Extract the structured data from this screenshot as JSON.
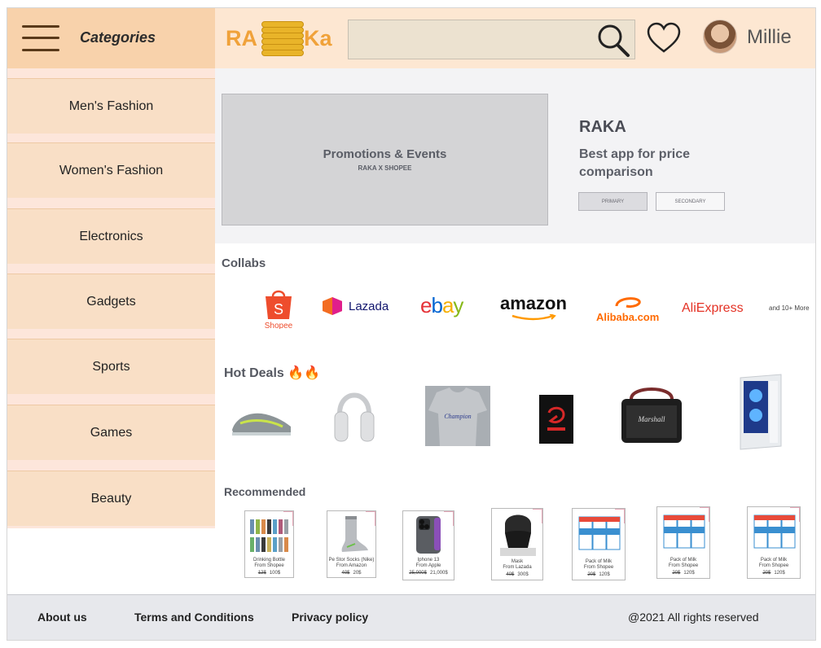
{
  "header": {
    "categories_title": "Categories",
    "logo_left": "RA",
    "logo_right": "Ka",
    "search_placeholder": "",
    "user_name": "Millie"
  },
  "sidebar": {
    "items": [
      {
        "label": "Men's Fashion"
      },
      {
        "label": "Women's Fashion"
      },
      {
        "label": "Electronics"
      },
      {
        "label": "Gadgets"
      },
      {
        "label": "Sports"
      },
      {
        "label": "Games"
      },
      {
        "label": "Beauty"
      }
    ]
  },
  "hero": {
    "promo_title": "Promotions & Events",
    "promo_subtitle": "RAKA X SHOPEE",
    "title": "RAKA",
    "description": "Best app for price comparison",
    "primary_label": "PRIMARY",
    "secondary_label": "SECONDARY"
  },
  "collabs": {
    "title": "Collabs",
    "brands": [
      "Shopee",
      "Lazada",
      "ebay",
      "amazon",
      "Alibaba.com",
      "AliExpress"
    ],
    "more": "and 10+ More"
  },
  "hot_deals": {
    "title": "Hot Deals 🔥🔥",
    "items": [
      "sneaker",
      "headphones",
      "t-shirt",
      "game-card",
      "speaker",
      "gaming-pc"
    ]
  },
  "recommended": {
    "title": "Recommended",
    "items": [
      {
        "name": "Drinking Bottle",
        "source": "From Shopee",
        "old_price": "12$",
        "price": "100$"
      },
      {
        "name": "Pe Stor Socks (Nike)",
        "source": "From Amazon",
        "old_price": "40$",
        "price": "20$"
      },
      {
        "name": "Iphone 13",
        "source": "From Apple",
        "old_price": "25,000$",
        "price": "21,000$"
      },
      {
        "name": "Mask",
        "source": "From Lazada",
        "old_price": "40$",
        "price": "300$"
      },
      {
        "name": "Pack of Milk",
        "source": "From Shopee",
        "old_price": "20$",
        "price": "120$"
      },
      {
        "name": "Pack of Milk",
        "source": "From Shopee",
        "old_price": "20$",
        "price": "120$"
      },
      {
        "name": "Pack of Milk",
        "source": "From Shopee",
        "old_price": "20$",
        "price": "120$"
      }
    ]
  },
  "footer": {
    "about": "About us",
    "terms": "Terms and Conditions",
    "privacy": "Privacy policy",
    "copyright": "@2021 All rights reserved"
  },
  "colors": {
    "sidebar_bg": "#f9dfc6",
    "header_bg": "#fde7d2",
    "logo": "#f0a23a",
    "footer_bg": "#e7e8ec"
  }
}
